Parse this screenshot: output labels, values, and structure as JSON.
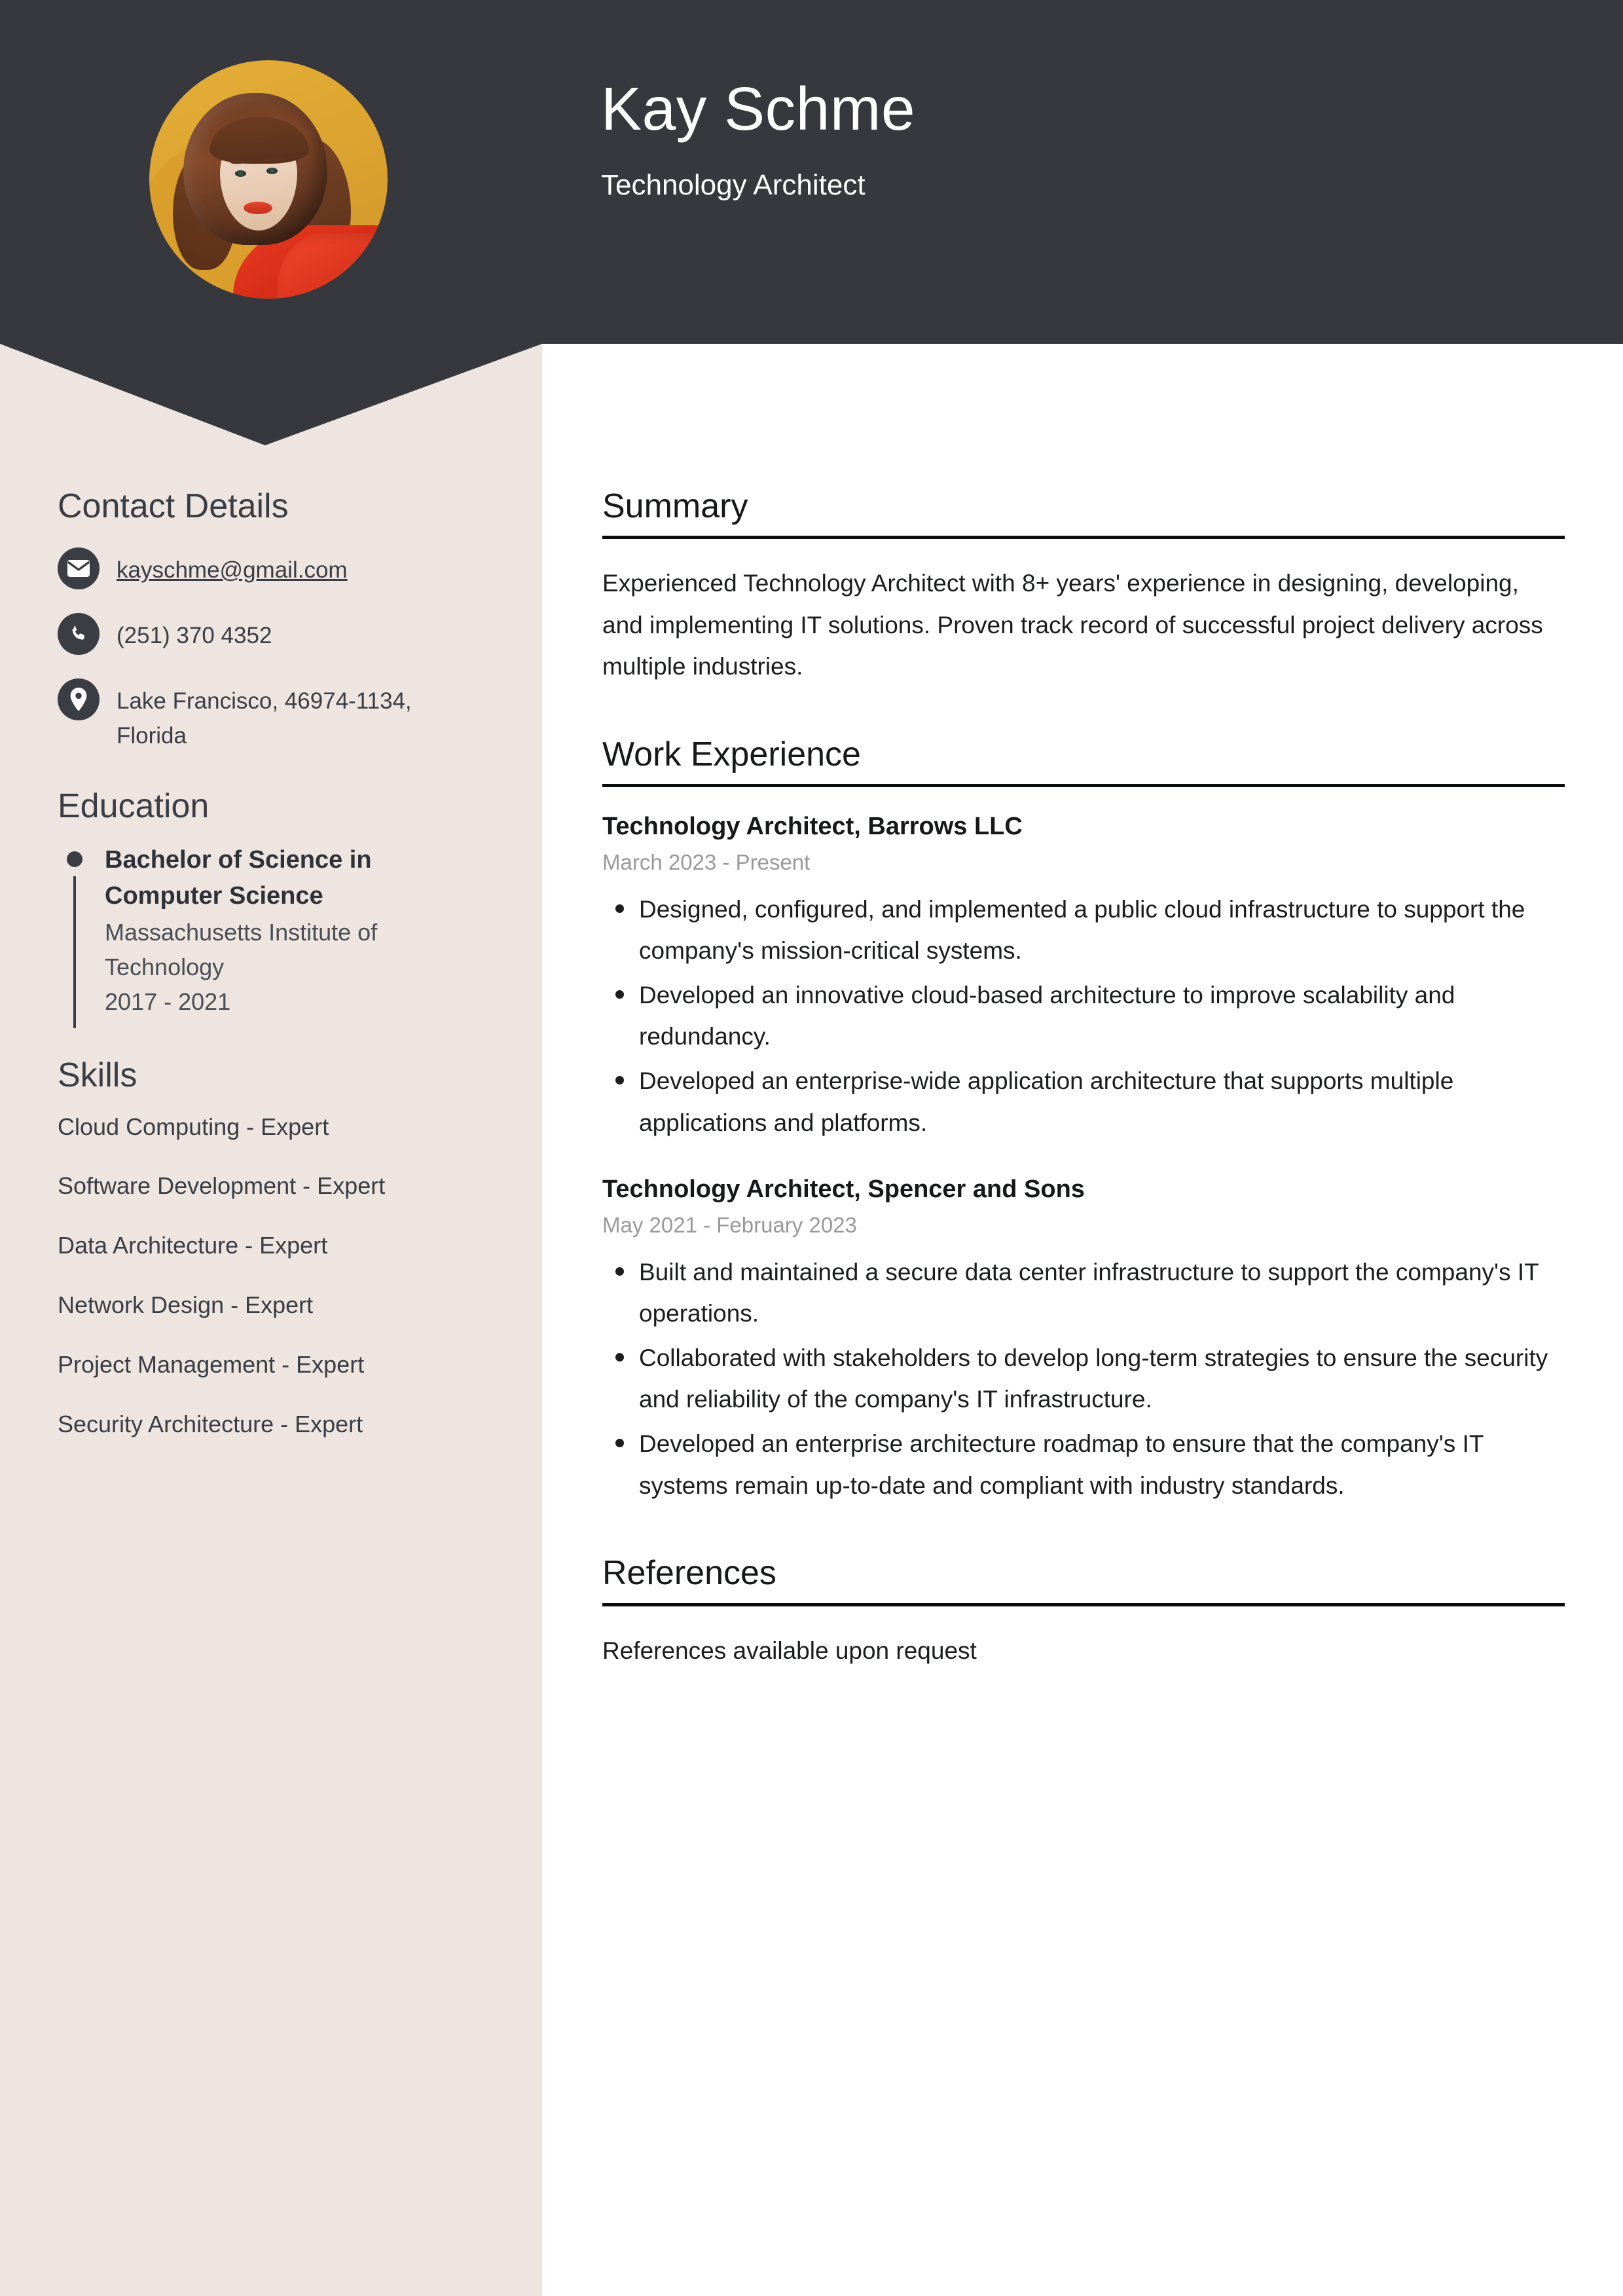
{
  "header": {
    "name": "Kay Schme",
    "role": "Technology Architect",
    "avatar_alt": "profile-photo"
  },
  "sidebar": {
    "contact": {
      "heading": "Contact Details",
      "items": [
        {
          "icon": "envelope-icon",
          "value": "kayschme@gmail.com",
          "is_link": true
        },
        {
          "icon": "phone-icon",
          "value": "(251) 370 4352",
          "is_link": false
        },
        {
          "icon": "map-pin-icon",
          "value": "Lake Francisco, 46974-1134, Florida",
          "is_link": false
        }
      ]
    },
    "education": {
      "heading": "Education",
      "entries": [
        {
          "degree": "Bachelor of Science in Computer Science",
          "school": "Massachusetts Institute of Technology",
          "dates": "2017 - 2021"
        }
      ]
    },
    "skills": {
      "heading": "Skills",
      "items": [
        "Cloud Computing - Expert",
        "Software Development - Expert",
        "Data Architecture - Expert",
        "Network Design - Expert",
        "Project Management - Expert",
        "Security Architecture - Expert"
      ]
    }
  },
  "main": {
    "summary": {
      "heading": "Summary",
      "text": "Experienced Technology Architect with 8+ years' experience in designing, developing, and implementing IT solutions. Proven track record of successful project delivery across multiple industries."
    },
    "work_experience": {
      "heading": "Work Experience",
      "jobs": [
        {
          "title": "Technology Architect, Barrows LLC",
          "dates": "March 2023 - Present",
          "bullets": [
            "Designed, configured, and implemented a public cloud infrastructure to support the company's mission-critical systems.",
            "Developed an innovative cloud-based architecture to improve scalability and redundancy.",
            "Developed an enterprise-wide application architecture that supports multiple applications and platforms."
          ]
        },
        {
          "title": "Technology Architect, Spencer and Sons",
          "dates": "May 2021 - February 2023",
          "bullets": [
            "Built and maintained a secure data center infrastructure to support the company's IT operations.",
            "Collaborated with stakeholders to develop long-term strategies to ensure the security and reliability of the company's IT infrastructure.",
            "Developed an enterprise architecture roadmap to ensure that the company's IT systems remain up-to-date and compliant with industry standards."
          ]
        }
      ]
    },
    "references": {
      "heading": "References",
      "text": "References available upon request"
    }
  },
  "colors": {
    "header_dark": "#36383D",
    "sidebar_beige": "#EEE5E0",
    "main_bg": "#FFFFFF",
    "heading_dark": "#17181A",
    "sidebar_heading": "#3A3D44",
    "muted_date": "#9A9A9C",
    "avatar_bg": "#DDA430"
  }
}
